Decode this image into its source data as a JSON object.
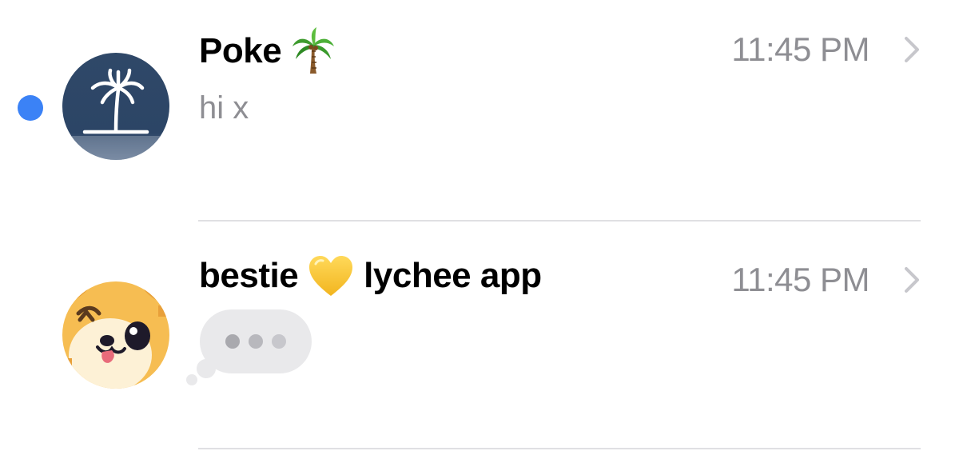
{
  "conversations": [
    {
      "name": "Poke",
      "name_emoji": "palm-tree",
      "time": "11:45 PM",
      "preview": "hi x",
      "unread": true,
      "avatar_icon": "palm-island-icon",
      "avatar_color": "#2f4a6b"
    },
    {
      "name_left": "bestie",
      "name_emoji": "yellow-heart",
      "name_right": "lychee app",
      "time": "11:45 PM",
      "preview_state": "typing",
      "unread": false,
      "avatar_icon": "winking-dog-icon",
      "avatar_color": "#f2b84b"
    }
  ],
  "colors": {
    "unread_blue": "#3b82f6",
    "secondary_gray": "#8e8e93",
    "divider": "#e0e0e3"
  }
}
